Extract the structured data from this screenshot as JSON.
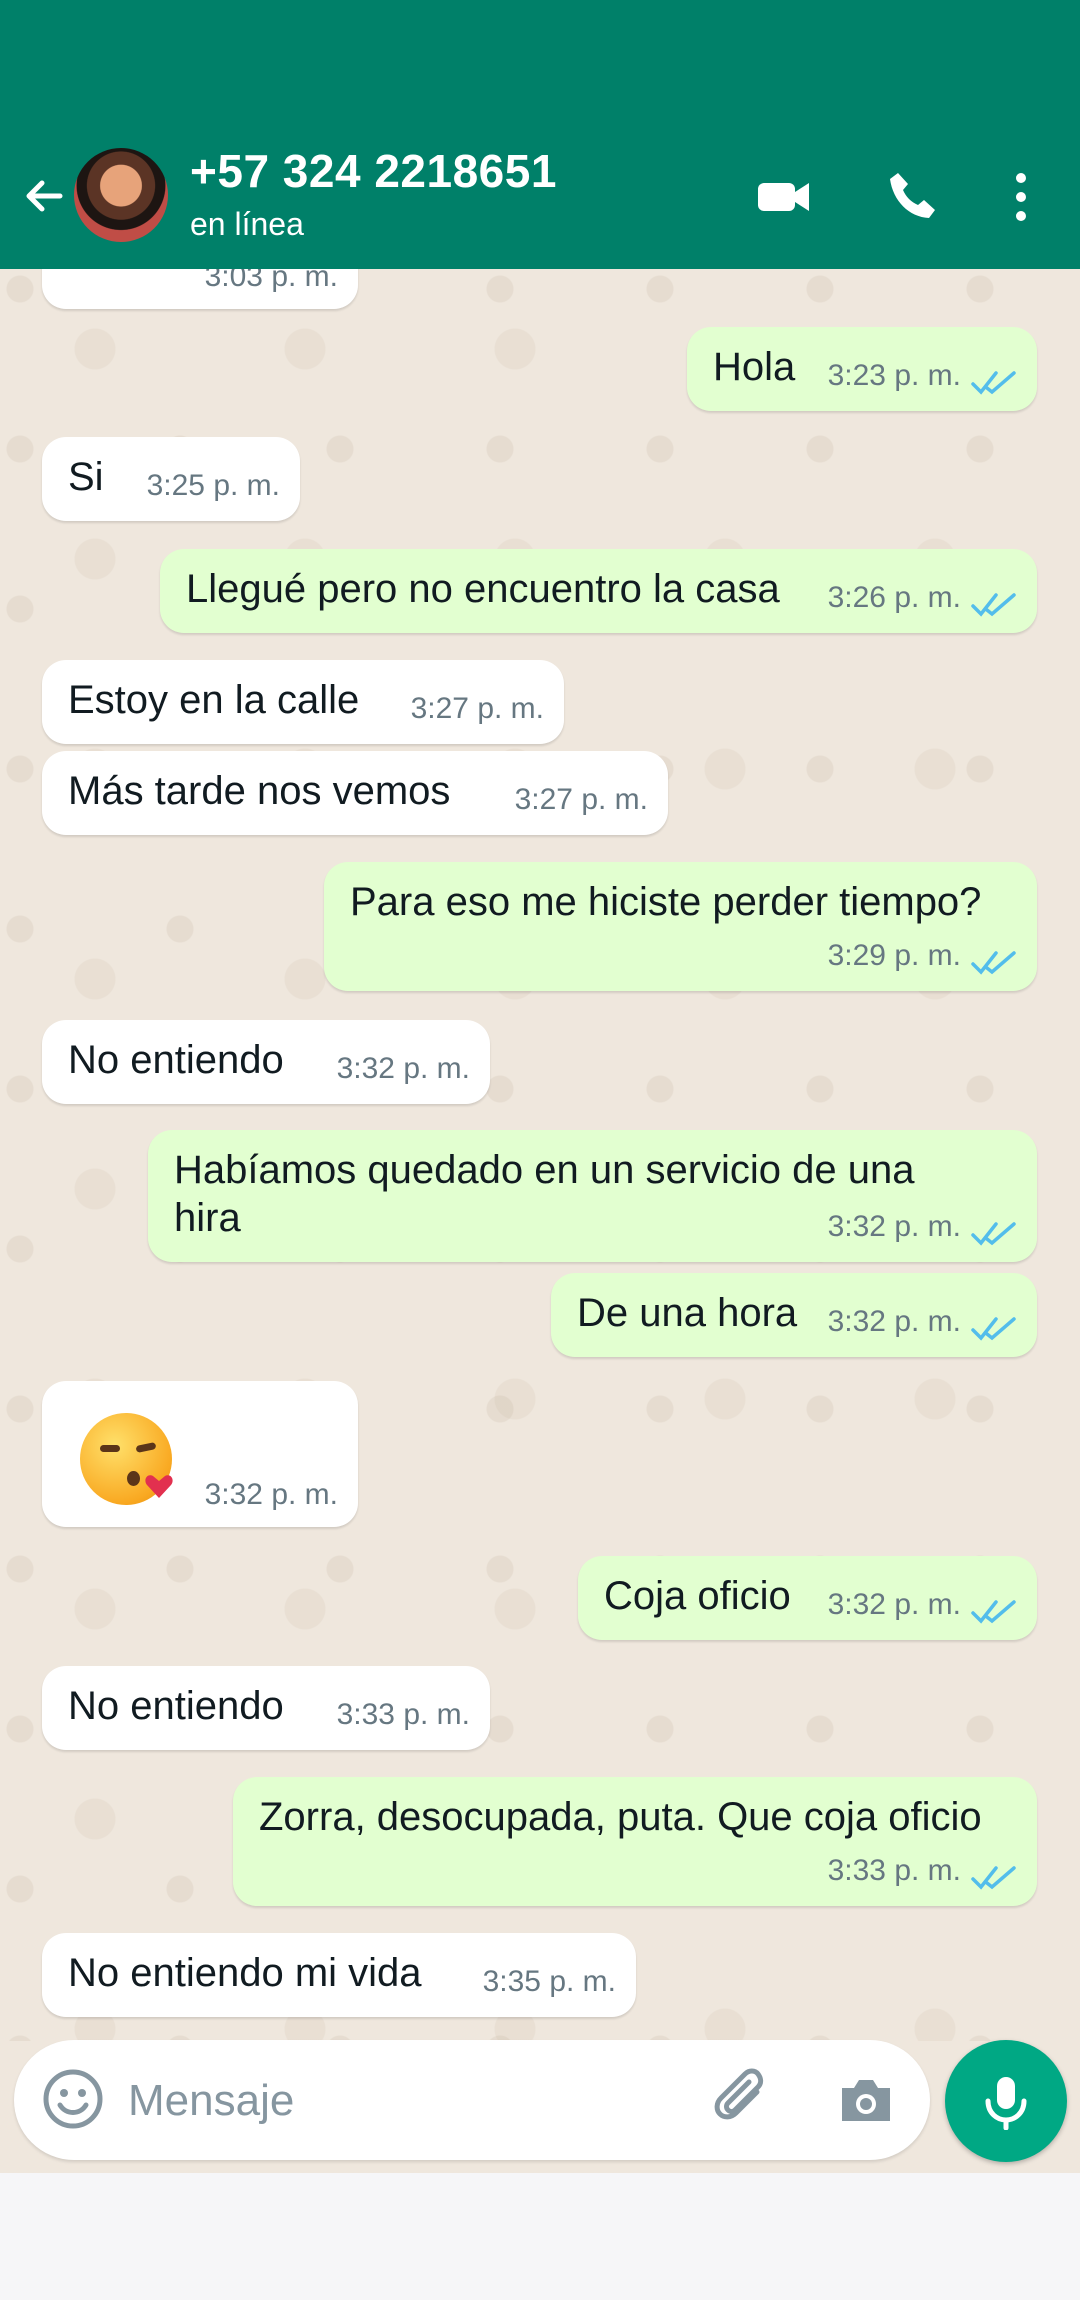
{
  "header": {
    "title": "+57 324 2218651",
    "subtitle": "en línea",
    "background": "#008069",
    "icons": [
      "back-arrow-icon",
      "video-call-icon",
      "voice-call-icon",
      "more-options-icon"
    ]
  },
  "messages": [
    {
      "direction": "in",
      "text": "",
      "time": "3:03 p. m."
    },
    {
      "direction": "out",
      "text": "Hola",
      "time": "3:23 p. m.",
      "status": "read"
    },
    {
      "direction": "in",
      "text": "Si",
      "time": "3:25 p. m."
    },
    {
      "direction": "out",
      "text": "Llegué pero no encuentro la casa",
      "time": "3:26 p. m.",
      "status": "read"
    },
    {
      "direction": "in",
      "text": "Estoy en la calle",
      "time": "3:27 p. m."
    },
    {
      "direction": "in",
      "text": "Más tarde nos vemos",
      "time": "3:27 p. m."
    },
    {
      "direction": "out",
      "text": "Para eso me hiciste perder tiempo?",
      "time": "3:29 p. m.",
      "status": "read"
    },
    {
      "direction": "in",
      "text": "No entiendo",
      "time": "3:32 p. m."
    },
    {
      "direction": "out",
      "text": "Habíamos quedado en un servicio de una hira",
      "time": "3:32 p. m.",
      "status": "read"
    },
    {
      "direction": "out",
      "text": "De una hora",
      "time": "3:32 p. m.",
      "status": "read"
    },
    {
      "direction": "in",
      "text": "",
      "time": "3:32 p. m.",
      "emoji": "kiss-emoji-icon"
    },
    {
      "direction": "out",
      "text": "Coja oficio",
      "time": "3:32 p. m.",
      "status": "read"
    },
    {
      "direction": "in",
      "text": "No entiendo",
      "time": "3:33 p. m."
    },
    {
      "direction": "out",
      "text": "Zorra, desocupada, puta. Que coja oficio",
      "time": "3:33 p. m.",
      "status": "read"
    },
    {
      "direction": "in",
      "text": "No entiendo mi vida",
      "time": "3:35 p. m."
    }
  ],
  "composer": {
    "placeholder": "Mensaje",
    "icons": [
      "emoji-icon",
      "attach-icon",
      "camera-icon",
      "microphone-icon"
    ]
  },
  "colors": {
    "incoming_bubble": "#ffffff",
    "outgoing_bubble": "#e2ffd0",
    "read_ticks": "#53bdeb",
    "accent": "#00a884"
  }
}
